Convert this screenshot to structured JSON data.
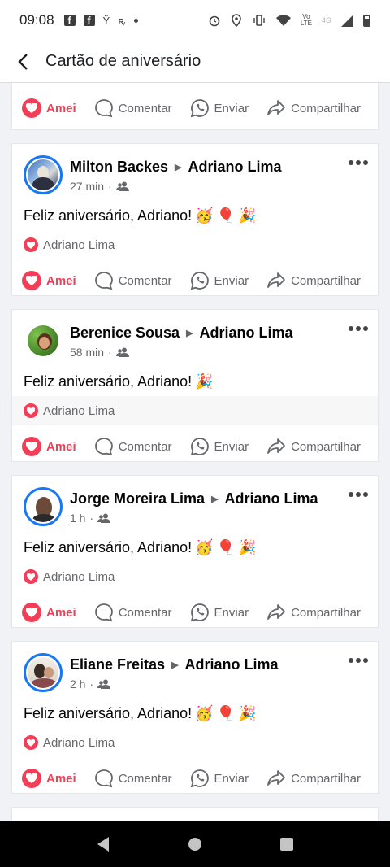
{
  "status_bar": {
    "time": "09:08",
    "lte_label": "Vo\nLTE",
    "net_label": "4G"
  },
  "app_bar": {
    "title": "Cartão de aniversário"
  },
  "actions": {
    "love": "Amei",
    "comment": "Comentar",
    "send": "Enviar",
    "share": "Compartilhar"
  },
  "posts": [
    {
      "author": "Milton Backes",
      "target": "Adriano Lima",
      "time": "27 min",
      "text": "Feliz aniversário, Adriano!",
      "emojis": [
        "🥳",
        "🎈",
        " 🎉"
      ],
      "reactor": "Adriano Lima"
    },
    {
      "author": "Berenice Sousa",
      "target": "Adriano Lima",
      "time": "58 min",
      "text": "Feliz aniversário, Adriano!",
      "emojis": [
        "🎉"
      ],
      "reactor": "Adriano Lima"
    },
    {
      "author": "Jorge Moreira Lima",
      "target": "Adriano Lima",
      "time": "1 h",
      "text": "Feliz aniversário, Adriano!",
      "emojis": [
        "🥳",
        "🎈",
        " 🎉"
      ],
      "reactor": "Adriano Lima"
    },
    {
      "author": "Eliane Freitas",
      "target": "Adriano Lima",
      "time": "2 h",
      "text": "Feliz aniversário, Adriano!",
      "emojis": [
        "🥳",
        "🎈",
        " 🎉"
      ],
      "reactor": "Adriano Lima"
    }
  ],
  "colors": {
    "love": "#f33e58",
    "avatar_ring": "#1877f2",
    "secondary_text": "#65676b"
  }
}
